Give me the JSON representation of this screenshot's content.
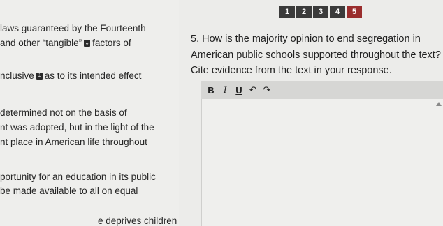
{
  "question_nav": [
    "1",
    "2",
    "3",
    "4",
    "5"
  ],
  "passage": {
    "line1": "laws guaranteed by the Fourteenth",
    "line2a": "and other “tangible”",
    "line2b": "factors of",
    "line3a": "nclusive",
    "line3b": "as to its intended effect",
    "line4": "determined not on the basis of",
    "line5": "nt was adopted, but in the light of the",
    "line6": "nt place in American life throughout",
    "line7": "portunity for an education in its public",
    "line8": "be made available to all on equal",
    "line9": "e deprives children"
  },
  "question": {
    "text": "5. How is the majority opinion to end segregation in American public schools supported throughout the text? Cite evidence from the text in your response."
  },
  "toolbar": {
    "bold": "B",
    "italic": "I",
    "underline": "U",
    "undo": "↶",
    "redo": "↷"
  }
}
